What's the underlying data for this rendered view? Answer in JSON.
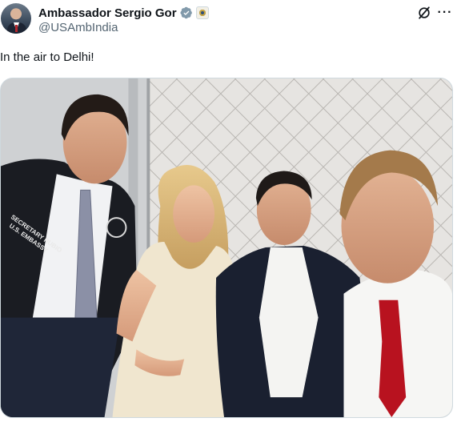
{
  "author": {
    "display_name": "Ambassador Sergio Gor",
    "handle": "@USAmbIndia",
    "verified_icon": "verified-badge-icon",
    "affiliation_icon": "government-seal-icon"
  },
  "actions": {
    "grok_icon": "grok-icon",
    "more_icon": "more-options-icon",
    "more_label": "···"
  },
  "tweet": {
    "text": "In the air to Delhi!"
  },
  "media": {
    "jacket_lettering": "SECRETARY RUBIO U.S. EMBASSY"
  },
  "colors": {
    "verified": "#829aab",
    "text_primary": "#0f1419",
    "text_secondary": "#536471",
    "tie_red": "#b8121f"
  }
}
